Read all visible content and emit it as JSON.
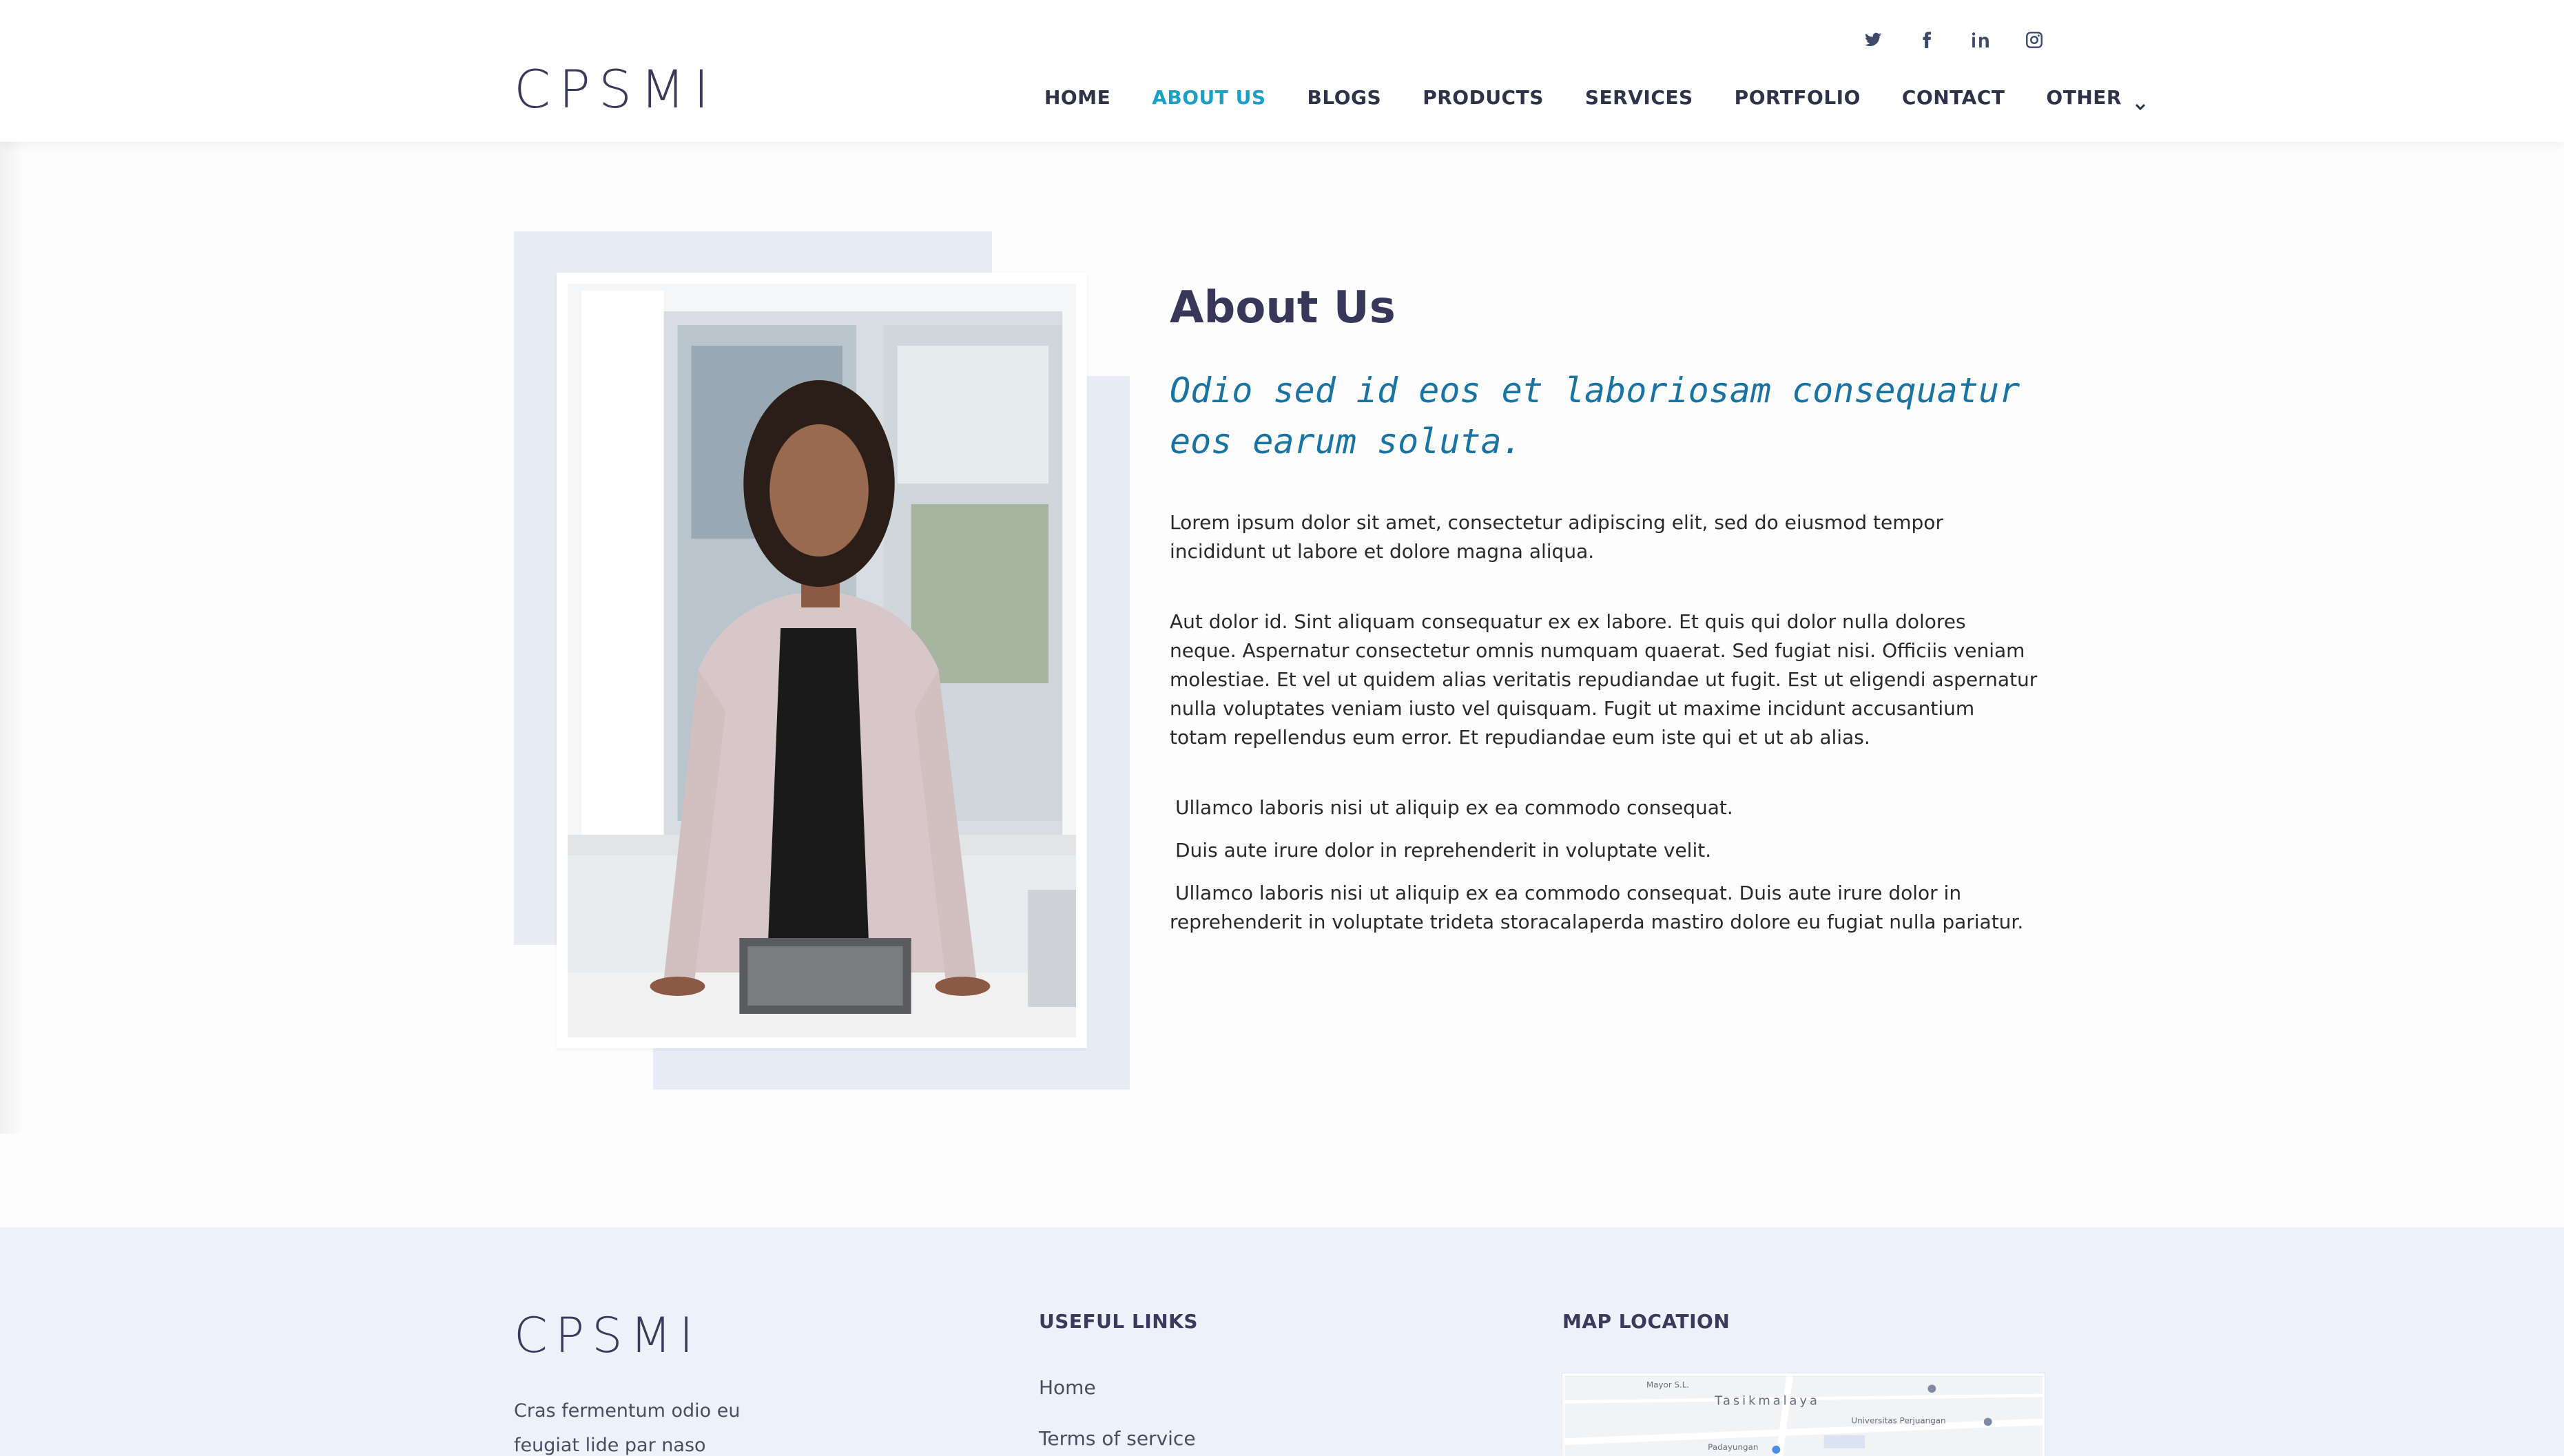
{
  "header": {
    "logo": "CPSMI",
    "social": [
      {
        "name": "twitter-icon"
      },
      {
        "name": "facebook-icon"
      },
      {
        "name": "linkedin-icon"
      },
      {
        "name": "instagram-icon"
      }
    ],
    "nav": {
      "home": "HOME",
      "about": "ABOUT US",
      "blogs": "BLOGS",
      "products": "PRODUCTS",
      "services": "SERVICES",
      "portfolio": "PORTFOLIO",
      "contact": "CONTACT",
      "other": "OTHER"
    },
    "active_nav": "ABOUT US",
    "accent_color": "#1aa0c9"
  },
  "about": {
    "title": "About Us",
    "subtitle": "Odio sed id eos et laboriosam consequatur eos earum soluta.",
    "paragraph1": "Lorem ipsum dolor sit amet, consectetur adipiscing elit, sed do eiusmod tempor incididunt ut labore et dolore magna aliqua.",
    "paragraph2": "Aut dolor id. Sint aliquam consequatur ex ex labore. Et quis qui dolor nulla dolores neque. Aspernatur consectetur omnis numquam quaerat. Sed fugiat nisi. Officiis veniam molestiae. Et vel ut quidem alias veritatis repudiandae ut fugit. Est ut eligendi aspernatur nulla voluptates veniam iusto vel quisquam. Fugit ut maxime incidunt accusantium totam repellendus eum error. Et repudiandae eum iste qui et ut ab alias.",
    "list": [
      "Ullamco laboris nisi ut aliquip ex ea commodo consequat.",
      "Duis aute irure dolor in reprehenderit in voluptate velit.",
      "Ullamco laboris nisi ut aliquip ex ea commodo consequat. Duis aute irure dolor in reprehenderit in voluptate trideta storacalaperda mastiro dolore eu fugiat nulla pariatur."
    ],
    "subtitle_color": "#1a74a3"
  },
  "footer": {
    "logo": "CPSMI",
    "text": "Cras fermentum odio eu feugiat lide par naso",
    "useful_links_heading": "USEFUL LINKS",
    "links": [
      "Home",
      "Terms of service"
    ],
    "map_heading": "MAP LOCATION",
    "map_labels": {
      "city": "Tasikmalaya",
      "poi1": "Universitas Perjuangan",
      "poi2": "Padayungan",
      "road": "Mayor S.L."
    }
  }
}
